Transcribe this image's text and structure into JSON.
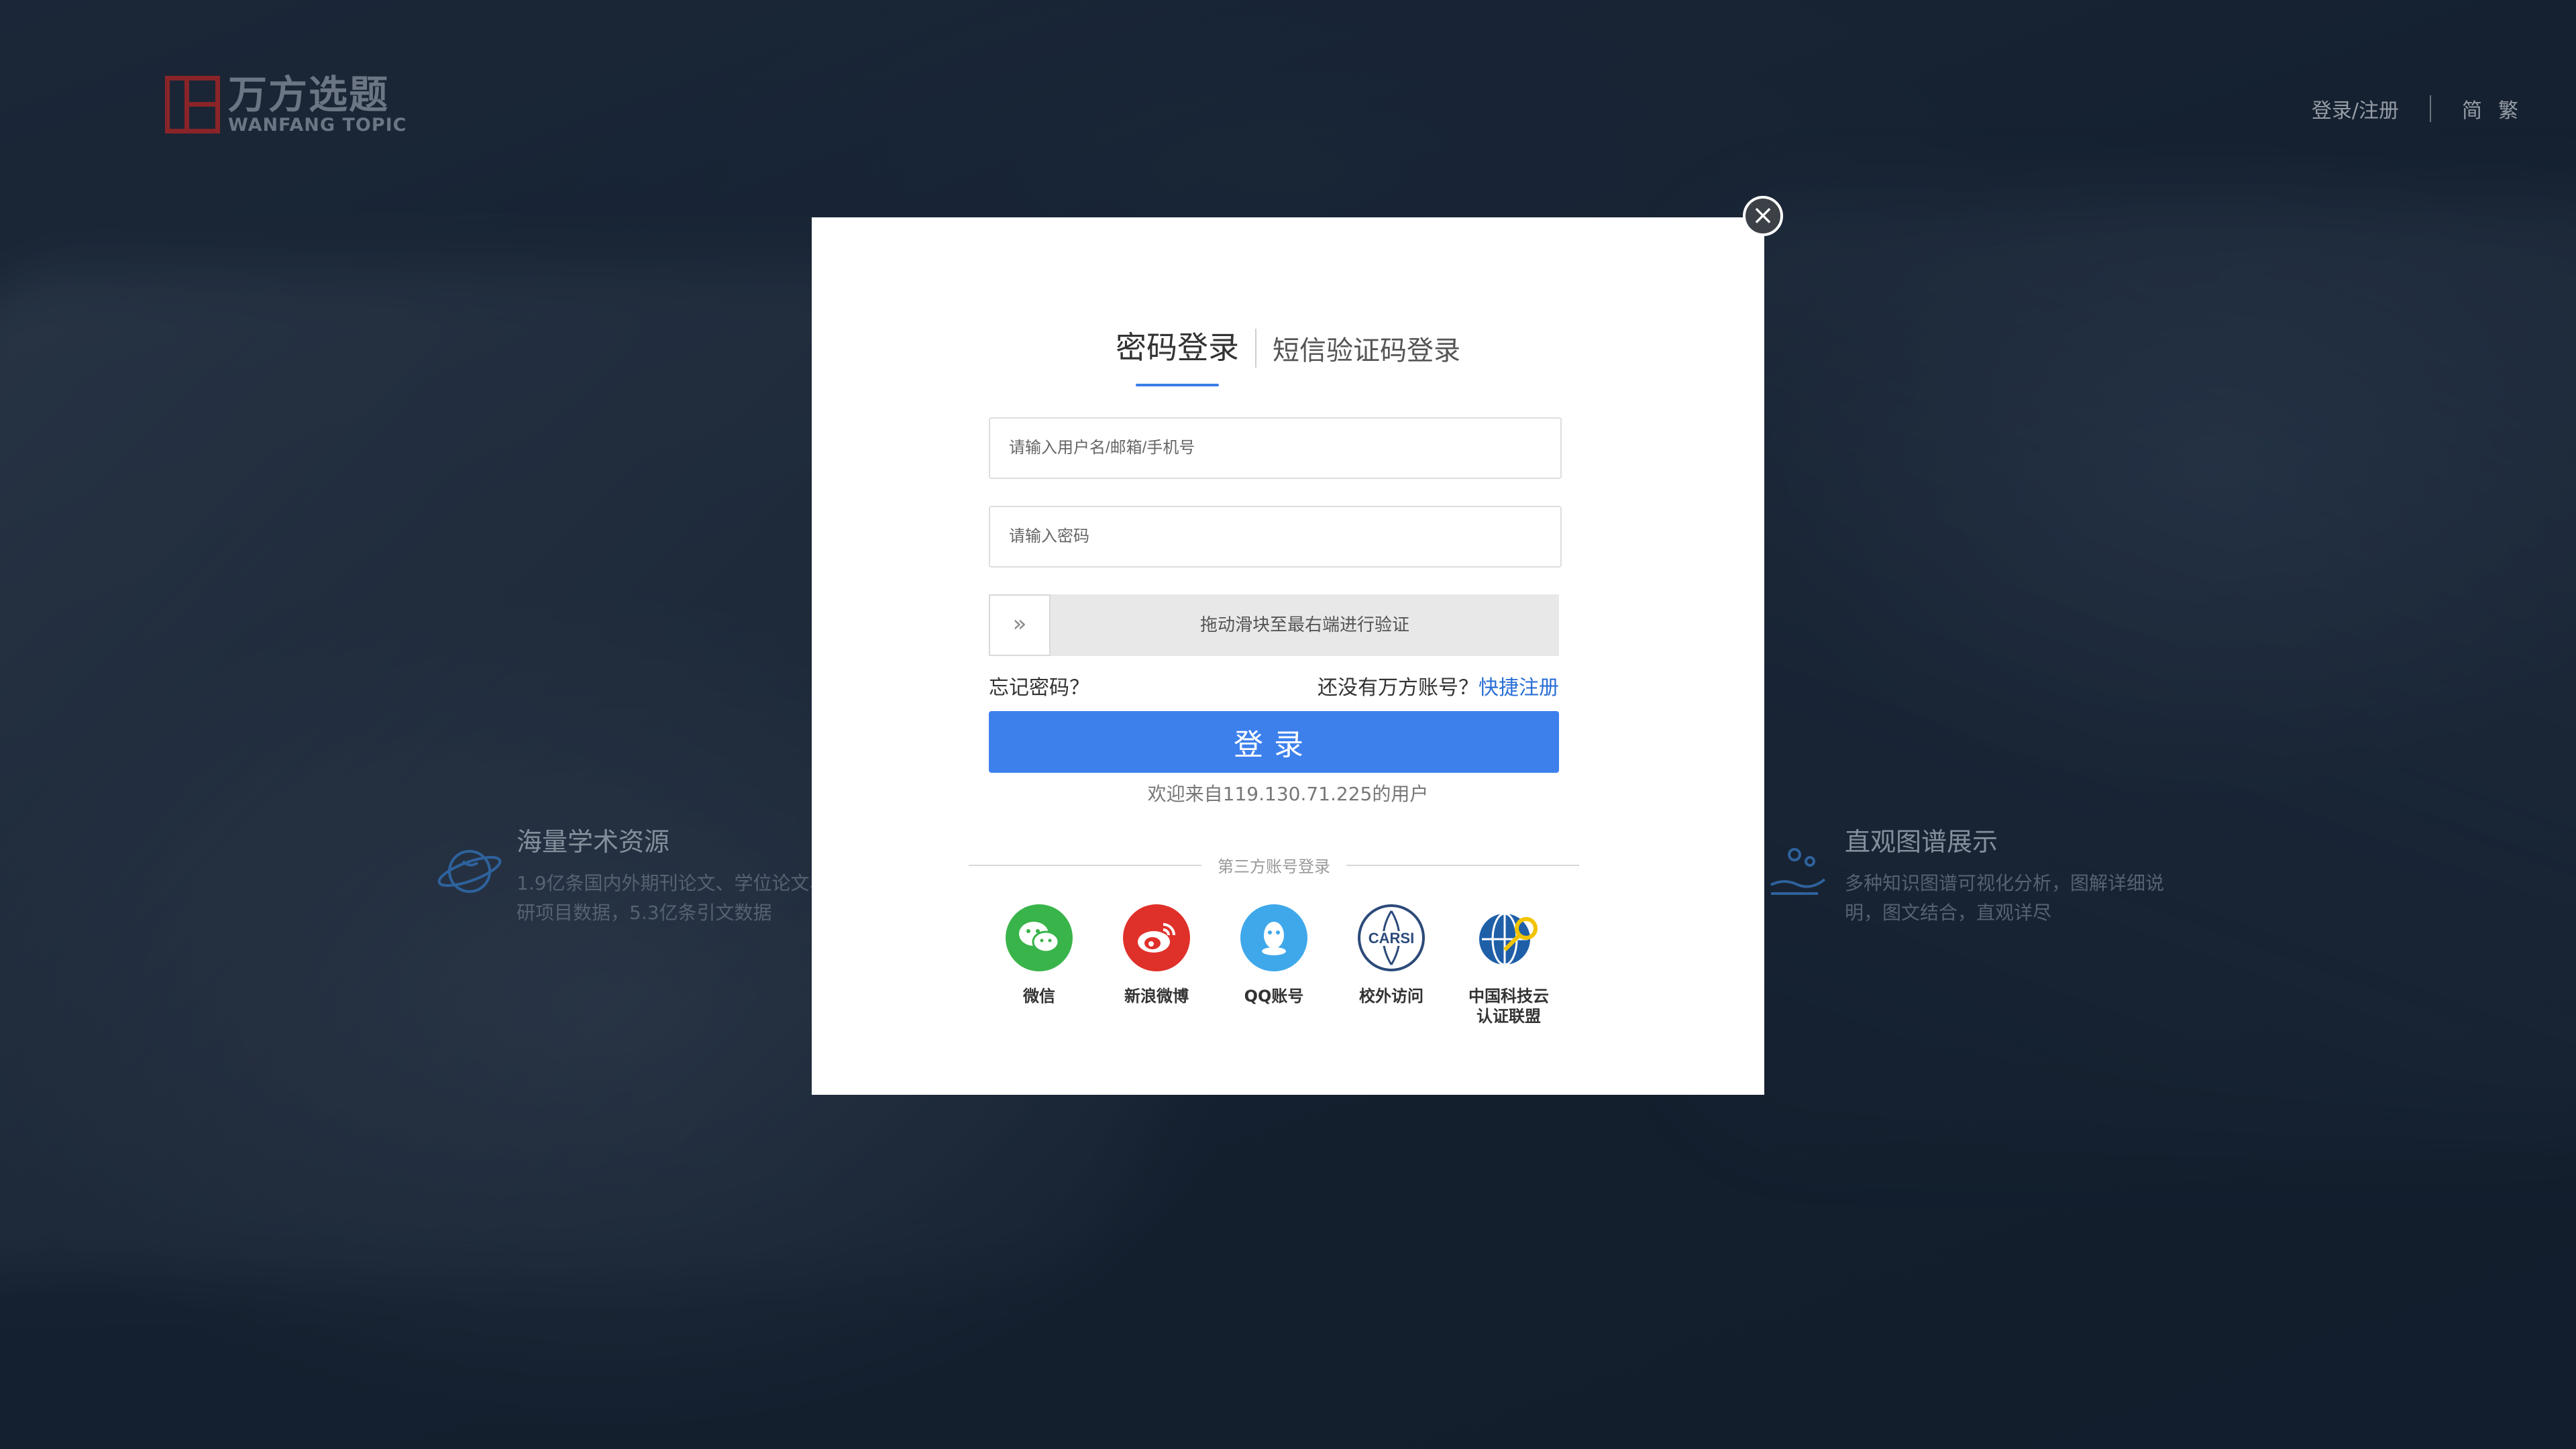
{
  "header": {
    "logo_cn": "万方选题",
    "logo_en": "WANFANG TOPIC",
    "login_register": "登录/注册",
    "lang_simplified": "简",
    "lang_traditional": "繁"
  },
  "features": [
    {
      "title": "海量学术资源",
      "desc": "1.9亿条国内外期刊论文、学位论文、科研项目数据，5.3亿条引文数据"
    },
    {
      "title": "直观图谱展示",
      "desc": "多种知识图谱可视化分析，图解详细说明，图文结合，直观详尽"
    }
  ],
  "modal": {
    "close_symbol": "×",
    "tab_password": "密码登录",
    "tab_sms": "短信验证码登录",
    "username_placeholder": "请输入用户名/邮箱/手机号",
    "password_placeholder": "请输入密码",
    "slider_handle": "»",
    "slider_text": "拖动滑块至最右端进行验证",
    "forgot_password": "忘记密码？",
    "no_account": "还没有万方账号？",
    "quick_register": "快捷注册",
    "login_button": "登录",
    "welcome": "欢迎来自119.130.71.225的用户",
    "third_party_title": "第三方账号登录",
    "social": [
      {
        "label": "微信",
        "icon": "wechat-icon",
        "color": "#39b44a"
      },
      {
        "label": "新浪微博",
        "icon": "weibo-icon",
        "color": "#e0302a"
      },
      {
        "label": "QQ账号",
        "icon": "qq-icon",
        "color": "#3fa8ea"
      },
      {
        "label": "校外访问",
        "icon": "carsi-icon",
        "color": "#2c4a7a"
      },
      {
        "label": "中国科技云认证联盟",
        "label_line1": "中国科技云",
        "label_line2": "认证联盟",
        "icon": "cstcloud-icon",
        "color": "#1f5fa8"
      }
    ]
  },
  "colors": {
    "primary": "#3d80ec",
    "link": "#2a6fd6",
    "logo_red": "#b32a2a"
  }
}
